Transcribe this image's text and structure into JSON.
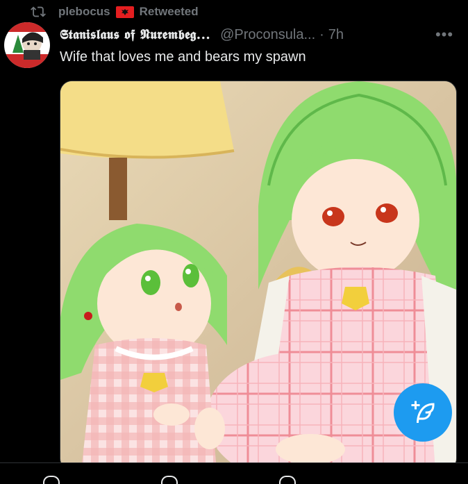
{
  "retweet": {
    "icon": "retweet-icon",
    "user": "plebocus",
    "flag": "albania-flag",
    "label": "Retweeted"
  },
  "tweet": {
    "display_name": "𝕾𝖙𝖆𝖓𝖎𝖘𝖑𝖆𝖚𝖘 𝖔𝖋 𝕹𝖚𝖗𝖊𝖒𝖇𝖊𝖌...",
    "handle": "@Proconsula...",
    "separator": "·",
    "time": "7h",
    "more_label": "•••",
    "text": "Wife that loves me and bears my spawn",
    "media_icon": "anime-illustration-image"
  },
  "fab": {
    "icon": "compose-feather-plus-icon"
  },
  "colors": {
    "background": "#000000",
    "text_primary": "#e7e9ea",
    "text_secondary": "#71767b",
    "accent": "#1d9bf0",
    "border": "#2f3336"
  }
}
